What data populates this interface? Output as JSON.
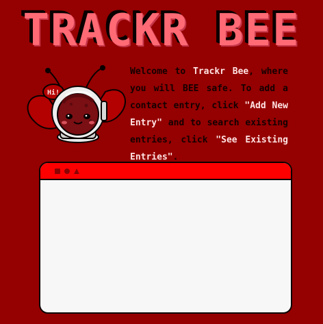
{
  "app": {
    "title": "TRACKR BEE"
  },
  "intro": {
    "p1": "Welcome to ",
    "app_name": "Trackr Bee",
    "p2": ", where you will BEE safe. To add a contact entry, click ",
    "add_label": "\"Add New Entry\"",
    "p3": " and to search existing entries, click ",
    "see_label": "\"See Existing Entries\"",
    "p4": "."
  },
  "mascot": {
    "bubble_text": "Hi!"
  },
  "window": {
    "controls": [
      "square-icon",
      "circle-icon",
      "triangle-icon"
    ]
  },
  "colors": {
    "background": "#950000",
    "title": "#ff6a75",
    "window_bar": "#ff0000",
    "window_body": "#f7f7f7",
    "text_dark": "#140000",
    "text_highlight": "#ffe3e3"
  }
}
